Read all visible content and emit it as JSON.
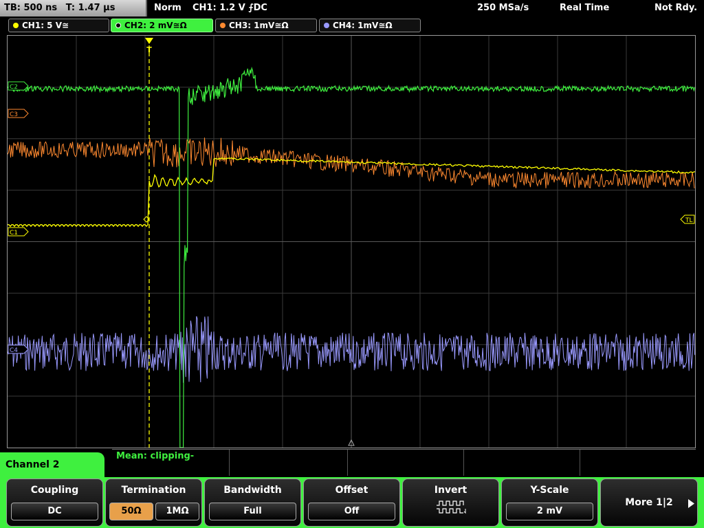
{
  "topbar": {
    "timebase": "TB: 500 ns",
    "trigger_time": "T: 1.47 µs",
    "mode": "Norm",
    "trigger": "CH1: 1.2 V ⨍DC",
    "sample_rate": "250 MSa/s",
    "acq_mode": "Real Time",
    "status": "Not Rdy."
  },
  "channels": [
    {
      "label": "CH1: 5 V≅",
      "color": "#ffff00"
    },
    {
      "label": "CH2: 2 mV≅Ω",
      "color": "#3ff03f"
    },
    {
      "label": "CH3: 1mV≅Ω",
      "color": "#ff8a30"
    },
    {
      "label": "CH4: 1mV≅Ω",
      "color": "#9a9aff"
    }
  ],
  "markers": {
    "ch2": "C2",
    "ch3": "C3",
    "ch1": "C1",
    "ch4": "C4",
    "trigger_level": "TL",
    "trigger_pos": "T"
  },
  "measurement": {
    "text": "Mean: clipping-"
  },
  "panel": {
    "title": "Channel 2"
  },
  "softkeys": {
    "coupling": {
      "title": "Coupling",
      "value": "DC"
    },
    "termination": {
      "title": "Termination",
      "options": [
        "50Ω",
        "1MΩ"
      ],
      "selected": "50Ω"
    },
    "bandwidth": {
      "title": "Bandwidth",
      "value": "Full"
    },
    "offset": {
      "title": "Offset",
      "value": "Off"
    },
    "invert": {
      "title": "Invert"
    },
    "yscale": {
      "title": "Y-Scale",
      "value": "2 mV"
    },
    "more": {
      "label": "More 1|2"
    }
  }
}
